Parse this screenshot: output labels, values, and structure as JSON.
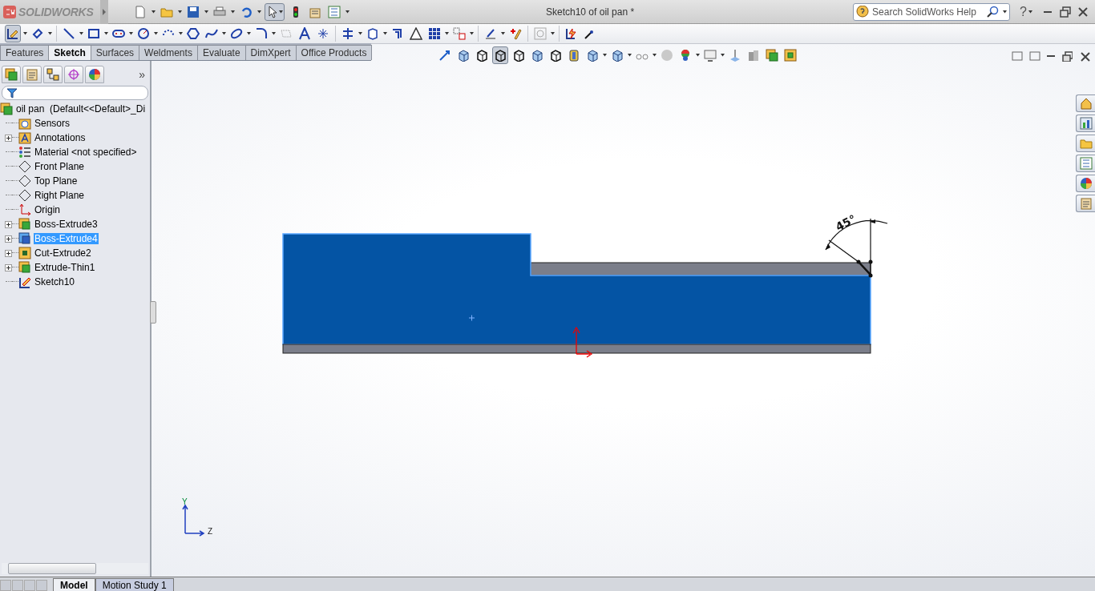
{
  "app": {
    "logo": "SOLIDWORKS",
    "title": "Sketch10 of oil pan *"
  },
  "search": {
    "placeholder": "Search SolidWorks Help"
  },
  "help": {
    "label": "?"
  },
  "toolbar_states": {
    "select_tool_on": true,
    "sketch_tool_on": true,
    "view_style_on": true
  },
  "command_tabs": [
    {
      "label": "Features",
      "selected": false
    },
    {
      "label": "Sketch",
      "selected": true
    },
    {
      "label": "Surfaces",
      "selected": false
    },
    {
      "label": "Weldments",
      "selected": false
    },
    {
      "label": "Evaluate",
      "selected": false
    },
    {
      "label": "DimXpert",
      "selected": false
    },
    {
      "label": "Office Products",
      "selected": false
    }
  ],
  "sidebar": {
    "more": "»",
    "tree": {
      "label": "oil pan  (Default<<Default>_Di",
      "children": [
        {
          "label": "Sensors",
          "kind": "sensors",
          "expander": false,
          "selected": false
        },
        {
          "label": "Annotations",
          "kind": "annotations",
          "expander": true,
          "selected": false
        },
        {
          "label": "Material <not specified>",
          "kind": "material",
          "expander": false,
          "selected": false
        },
        {
          "label": "Front Plane",
          "kind": "plane",
          "expander": false,
          "selected": false
        },
        {
          "label": "Top Plane",
          "kind": "plane",
          "expander": false,
          "selected": false
        },
        {
          "label": "Right Plane",
          "kind": "plane",
          "expander": false,
          "selected": false
        },
        {
          "label": "Origin",
          "kind": "origin",
          "expander": false,
          "selected": false
        },
        {
          "label": "Boss-Extrude3",
          "kind": "boss",
          "expander": true,
          "selected": false
        },
        {
          "label": "Boss-Extrude4",
          "kind": "boss",
          "expander": true,
          "selected": true
        },
        {
          "label": "Cut-Extrude2",
          "kind": "cut",
          "expander": true,
          "selected": false
        },
        {
          "label": "Extrude-Thin1",
          "kind": "boss",
          "expander": true,
          "selected": false
        },
        {
          "label": "Sketch10",
          "kind": "sketch",
          "expander": false,
          "selected": false
        }
      ]
    }
  },
  "canvas": {
    "dimension": "45°",
    "triad": {
      "y": "Y",
      "z": "Z"
    }
  },
  "bottom_tabs": [
    {
      "label": "Model",
      "selected": true
    },
    {
      "label": "Motion Study 1",
      "selected": false
    }
  ]
}
